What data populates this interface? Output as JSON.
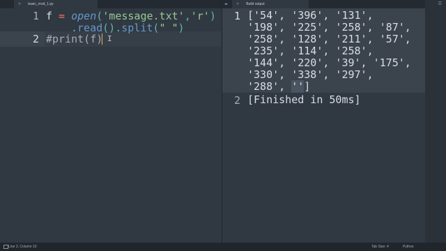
{
  "editor": {
    "tab_label": "basic_mod_1.py",
    "line_numbers": [
      "1",
      "2"
    ],
    "code": {
      "line1_var": "f",
      "line1_op": " = ",
      "line1_fn": "open",
      "line1_open_paren": "(",
      "line1_str1": "'message.txt'",
      "line1_comma": ",",
      "line1_str2": "'r'",
      "line1_close_paren": ")",
      "line1b_dot1": ".",
      "line1b_read": "read",
      "line1b_parens": "()",
      "line1b_dot2": ".",
      "line1b_split": "split",
      "line1b_open": "(",
      "line1b_str": "\" \"",
      "line1b_close": ")",
      "line2_comment": "#print(f)"
    }
  },
  "output": {
    "tab_label": "Build output",
    "line_numbers": [
      "1",
      "2"
    ],
    "lines": [
      "['54', '396', '131',",
      "'198', '225', '258', '87',",
      "'258', '128', '211', '57',",
      "'235', '114', '258',",
      "'144', '220', '39', '175',",
      "'330', '338', '297',",
      "'288', ''"
    ],
    "last_line_prefix": "'288', ",
    "last_line_sel": "''",
    "last_line_suffix": "]",
    "finished": "[Finished in 50ms]"
  },
  "status": {
    "position": "Line 2, Column 10",
    "tab_size": "Tab Size: 4",
    "syntax": "Python"
  },
  "icons": [
    "panel-icon",
    "close-icon",
    "tab-arrows-icon",
    "gear-icon",
    "text-cursor-icon"
  ]
}
